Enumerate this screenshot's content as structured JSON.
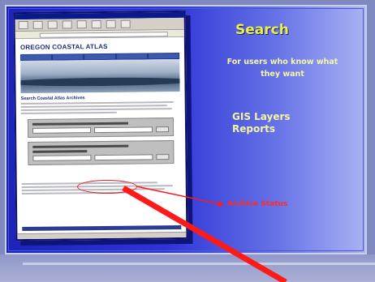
{
  "slide": {
    "title": "Search",
    "subtitle": "For users who know what they want",
    "bullets": [
      "GIS Layers",
      "Reports"
    ],
    "callout": "Archive Status"
  },
  "embedded_screenshot": {
    "site_title": "OREGON COASTAL ATLAS",
    "section_title": "Search Coastal Atlas Archives"
  },
  "colors": {
    "title": "#e8f04a",
    "callout": "#ff2a2a",
    "arrow": "#ff1a1a"
  }
}
